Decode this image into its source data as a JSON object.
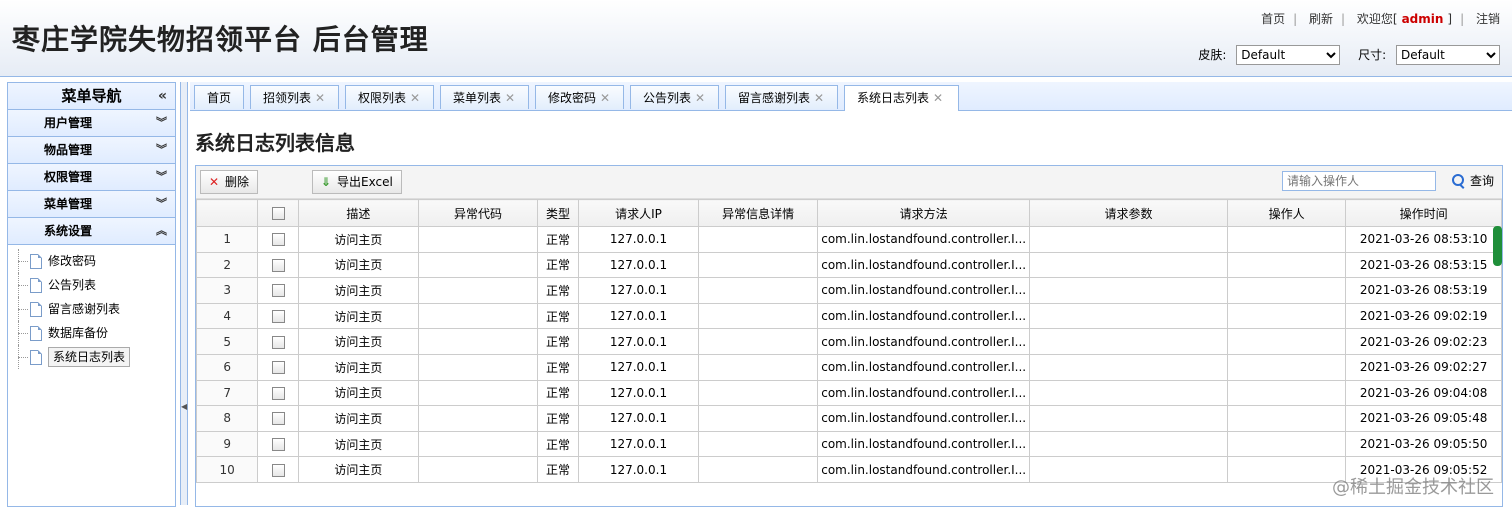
{
  "header": {
    "title": "枣庄学院失物招领平台 后台管理",
    "links": {
      "home": "首页",
      "refresh": "刷新",
      "welcome_prefix": "欢迎您[",
      "user": "admin",
      "welcome_suffix": "]",
      "logout": "注销"
    },
    "skin_label": "皮肤:",
    "skin_value": "Default",
    "size_label": "尺寸:",
    "size_value": "Default"
  },
  "sidebar": {
    "title": "菜单导航",
    "collapse_glyph": "«",
    "groups": [
      {
        "label": "用户管理",
        "chev": "︾"
      },
      {
        "label": "物品管理",
        "chev": "︾"
      },
      {
        "label": "权限管理",
        "chev": "︾"
      },
      {
        "label": "菜单管理",
        "chev": "︾"
      },
      {
        "label": "系统设置",
        "chev": "︽"
      }
    ],
    "items": [
      "修改密码",
      "公告列表",
      "留言感谢列表",
      "数据库备份",
      "系统日志列表"
    ]
  },
  "tabs": [
    {
      "label": "首页",
      "close": ""
    },
    {
      "label": "招领列表",
      "close": "✕"
    },
    {
      "label": "权限列表",
      "close": "✕"
    },
    {
      "label": "菜单列表",
      "close": "✕"
    },
    {
      "label": "修改密码",
      "close": "✕"
    },
    {
      "label": "公告列表",
      "close": "✕"
    },
    {
      "label": "留言感谢列表",
      "close": "✕"
    },
    {
      "label": "系统日志列表",
      "close": "✕"
    }
  ],
  "main": {
    "title": "系统日志列表信息",
    "toolbar": {
      "delete_label": "删除",
      "export_label": "导出Excel",
      "search_placeholder": "请输入操作人",
      "search_label": "查询"
    },
    "columns": [
      "描述",
      "异常代码",
      "类型",
      "请求人IP",
      "异常信息详情",
      "请求方法",
      "请求参数",
      "操作人",
      "操作时间"
    ],
    "rows": [
      {
        "n": "1",
        "desc": "访问主页",
        "code": "",
        "type": "正常",
        "ip": "127.0.0.1",
        "detail": "",
        "method": "com.lin.lostandfound.controller.I...",
        "params": "",
        "op": "",
        "time": "2021-03-26 08:53:10"
      },
      {
        "n": "2",
        "desc": "访问主页",
        "code": "",
        "type": "正常",
        "ip": "127.0.0.1",
        "detail": "",
        "method": "com.lin.lostandfound.controller.I...",
        "params": "",
        "op": "",
        "time": "2021-03-26 08:53:15"
      },
      {
        "n": "3",
        "desc": "访问主页",
        "code": "",
        "type": "正常",
        "ip": "127.0.0.1",
        "detail": "",
        "method": "com.lin.lostandfound.controller.I...",
        "params": "",
        "op": "",
        "time": "2021-03-26 08:53:19"
      },
      {
        "n": "4",
        "desc": "访问主页",
        "code": "",
        "type": "正常",
        "ip": "127.0.0.1",
        "detail": "",
        "method": "com.lin.lostandfound.controller.I...",
        "params": "",
        "op": "",
        "time": "2021-03-26 09:02:19"
      },
      {
        "n": "5",
        "desc": "访问主页",
        "code": "",
        "type": "正常",
        "ip": "127.0.0.1",
        "detail": "",
        "method": "com.lin.lostandfound.controller.I...",
        "params": "",
        "op": "",
        "time": "2021-03-26 09:02:23"
      },
      {
        "n": "6",
        "desc": "访问主页",
        "code": "",
        "type": "正常",
        "ip": "127.0.0.1",
        "detail": "",
        "method": "com.lin.lostandfound.controller.I...",
        "params": "",
        "op": "",
        "time": "2021-03-26 09:02:27"
      },
      {
        "n": "7",
        "desc": "访问主页",
        "code": "",
        "type": "正常",
        "ip": "127.0.0.1",
        "detail": "",
        "method": "com.lin.lostandfound.controller.I...",
        "params": "",
        "op": "",
        "time": "2021-03-26 09:04:08"
      },
      {
        "n": "8",
        "desc": "访问主页",
        "code": "",
        "type": "正常",
        "ip": "127.0.0.1",
        "detail": "",
        "method": "com.lin.lostandfound.controller.I...",
        "params": "",
        "op": "",
        "time": "2021-03-26 09:05:48"
      },
      {
        "n": "9",
        "desc": "访问主页",
        "code": "",
        "type": "正常",
        "ip": "127.0.0.1",
        "detail": "",
        "method": "com.lin.lostandfound.controller.I...",
        "params": "",
        "op": "",
        "time": "2021-03-26 09:05:50"
      },
      {
        "n": "10",
        "desc": "访问主页",
        "code": "",
        "type": "正常",
        "ip": "127.0.0.1",
        "detail": "",
        "method": "com.lin.lostandfound.controller.I...",
        "params": "",
        "op": "",
        "time": "2021-03-26 09:05:52"
      }
    ]
  },
  "watermark": "@稀土掘金技术社区",
  "colors": {
    "border": "#95b8e7",
    "user": "#cc0000",
    "scroll": "#1f8f3a"
  },
  "icons": {
    "delete": "close-x-icon",
    "export": "download-arrow-icon",
    "search": "search-icon",
    "page": "document-icon"
  }
}
